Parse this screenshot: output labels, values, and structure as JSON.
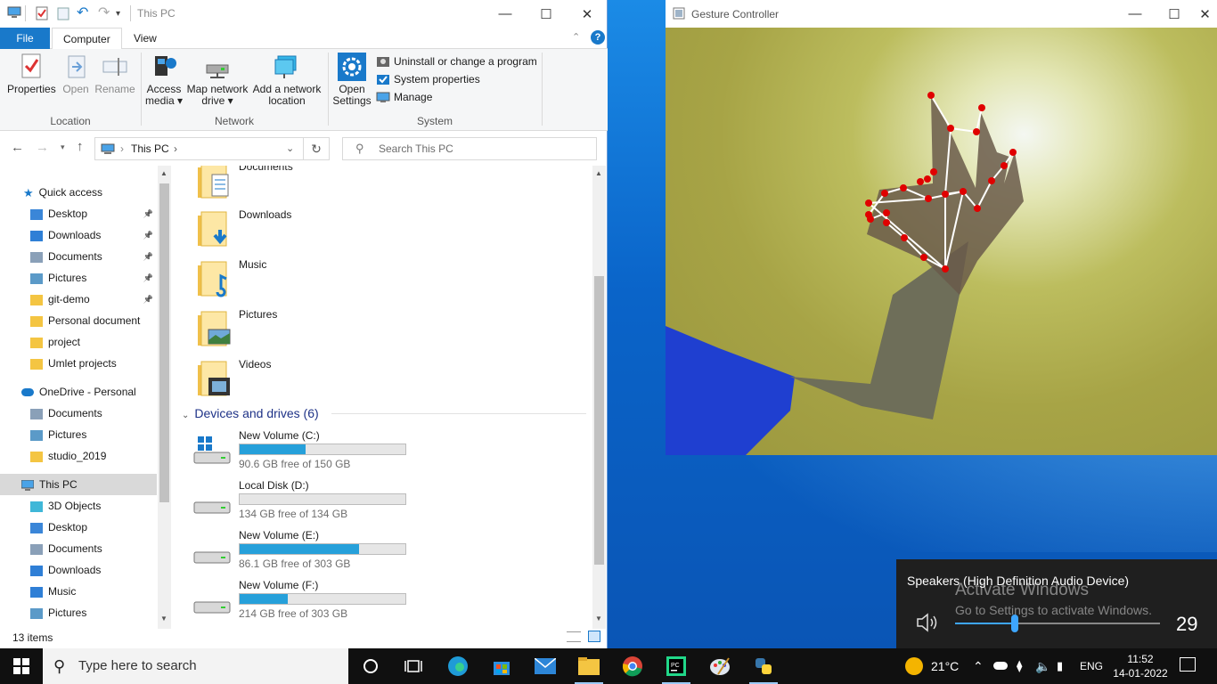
{
  "explorer": {
    "title": "This PC",
    "tabs": {
      "file": "File",
      "computer": "Computer",
      "view": "View"
    },
    "ribbon": {
      "location": {
        "label": "Location",
        "properties": "Properties",
        "open": "Open",
        "rename": "Rename"
      },
      "network": {
        "label": "Network",
        "access_media": "Access media",
        "map_drive": "Map network drive",
        "add_location": "Add a network location"
      },
      "system": {
        "label": "System",
        "open_settings": "Open Settings",
        "uninstall": "Uninstall or change a program",
        "system_properties": "System properties",
        "manage": "Manage"
      }
    },
    "address": {
      "path": "This PC",
      "search_placeholder": "Search This PC"
    },
    "nav": {
      "quick_access": "Quick access",
      "quick_items": [
        "Desktop",
        "Downloads",
        "Documents",
        "Pictures",
        "git-demo",
        "Personal document",
        "project",
        "Umlet projects"
      ],
      "onedrive": "OneDrive - Personal",
      "onedrive_items": [
        "Documents",
        "Pictures",
        "studio_2019"
      ],
      "this_pc": "This PC",
      "pc_items": [
        "3D Objects",
        "Desktop",
        "Documents",
        "Downloads",
        "Music",
        "Pictures"
      ]
    },
    "folders": [
      "Documents",
      "Downloads",
      "Music",
      "Pictures",
      "Videos"
    ],
    "devices_header": "Devices and drives (6)",
    "drives": [
      {
        "name": "New Volume (C:)",
        "free": "90.6 GB free of 150 GB",
        "used_fraction": 0.4
      },
      {
        "name": "Local Disk (D:)",
        "free": "134 GB free of 134 GB",
        "used_fraction": 0.0
      },
      {
        "name": "New Volume (E:)",
        "free": "86.1 GB free of 303 GB",
        "used_fraction": 0.72
      },
      {
        "name": "New Volume (F:)",
        "free": "214 GB free of 303 GB",
        "used_fraction": 0.29
      }
    ],
    "status": "13 items"
  },
  "gesture": {
    "title": "Gesture Controller"
  },
  "volume": {
    "device": "Speakers (High Definition Audio Device)",
    "level": "29",
    "level_fraction": 0.29
  },
  "watermark": {
    "line1": "Activate Windows",
    "line2": "Go to Settings to activate Windows."
  },
  "taskbar": {
    "search": "Type here to search",
    "weather": "21°C",
    "lang": "ENG",
    "time": "11:52",
    "date": "14-01-2022"
  },
  "colors": {
    "accent": "#1979ca",
    "drive_fill": "#26a0da",
    "landmark": "#e00000"
  }
}
